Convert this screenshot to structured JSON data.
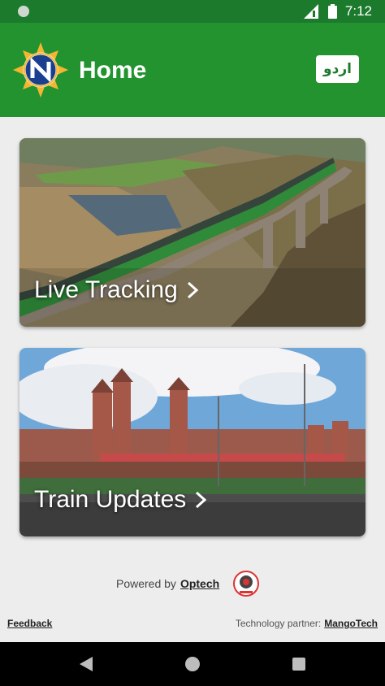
{
  "status_bar": {
    "time": "7:12"
  },
  "app_bar": {
    "title": "Home",
    "language_button": "اردو"
  },
  "cards": [
    {
      "label": "Live Tracking"
    },
    {
      "label": "Train Updates"
    }
  ],
  "footer": {
    "powered_prefix": "Powered by",
    "powered_by": "Optech",
    "feedback": "Feedback",
    "partner_prefix": "Technology partner:",
    "partner": "MangoTech"
  },
  "colors": {
    "brand_green": "#23932f",
    "status_green": "#1c7a2c"
  },
  "icons": {
    "status": [
      "signal-icon",
      "battery-icon"
    ],
    "cards": "chevron-right-icon",
    "nav": [
      "back-icon",
      "home-icon",
      "recent-apps-icon"
    ]
  }
}
